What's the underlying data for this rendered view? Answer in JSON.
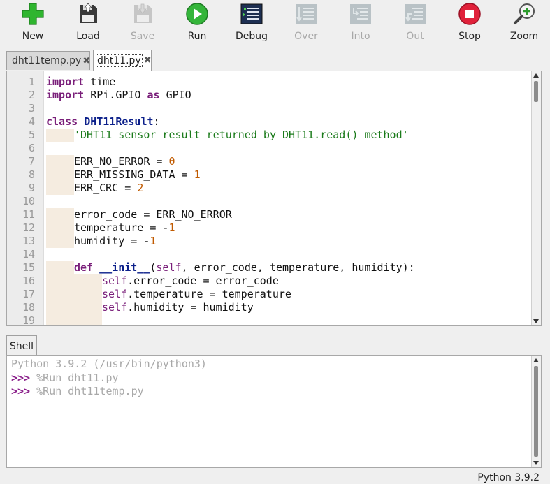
{
  "toolbar": {
    "items": [
      {
        "label": "New",
        "icon": "new-file-plus-icon",
        "enabled": true
      },
      {
        "label": "Load",
        "icon": "load-icon",
        "enabled": true
      },
      {
        "label": "Save",
        "icon": "save-icon",
        "enabled": false
      },
      {
        "label": "Run",
        "icon": "run-icon",
        "enabled": true
      },
      {
        "label": "Debug",
        "icon": "debug-icon",
        "enabled": true
      },
      {
        "label": "Over",
        "icon": "step-over-icon",
        "enabled": false
      },
      {
        "label": "Into",
        "icon": "step-into-icon",
        "enabled": false
      },
      {
        "label": "Out",
        "icon": "step-out-icon",
        "enabled": false
      },
      {
        "label": "Stop",
        "icon": "stop-icon",
        "enabled": true
      },
      {
        "label": "Zoom",
        "icon": "zoom-icon",
        "enabled": true
      }
    ]
  },
  "editor": {
    "tabs": [
      {
        "label": "dht11temp.py",
        "close": "✖",
        "active": false
      },
      {
        "label": "dht11.py",
        "close": "✖",
        "active": true
      }
    ],
    "line_numbers": [
      "1",
      "2",
      "3",
      "4",
      "5",
      "6",
      "7",
      "8",
      "9",
      "10",
      "11",
      "12",
      "13",
      "14",
      "15",
      "16",
      "17",
      "18",
      "19"
    ],
    "code": {
      "l1_kw": "import",
      "l1_rest": " time",
      "l2_kw": "import",
      "l2_mid": " RPi.GPIO ",
      "l2_as": "as",
      "l2_rest": " GPIO",
      "l4_kw": "class",
      "l4_name": "DHT11Result",
      "l4_colon": ":",
      "l5_str": "'DHT11 sensor result returned by DHT11.read() method'",
      "l7_a": "ERR_NO_ERROR = ",
      "l7_n": "0",
      "l8_a": "ERR_MISSING_DATA = ",
      "l8_n": "1",
      "l9_a": "ERR_CRC = ",
      "l9_n": "2",
      "l11_a": "error_code = ERR_NO_ERROR",
      "l12_a": "temperature = -",
      "l12_n": "1",
      "l13_a": "humidity = -",
      "l13_n": "1",
      "l15_kw": "def",
      "l15_name": "__init__",
      "l15_p": "(",
      "l15_self": "self",
      "l15_rest": ", error_code, temperature, humidity):",
      "l16_self": "self",
      "l16_rest": ".error_code = error_code",
      "l17_self": "self",
      "l17_rest": ".temperature = temperature",
      "l18_self": "self",
      "l18_rest": ".humidity = humidity"
    }
  },
  "shell": {
    "tab_label": "Shell",
    "version_line": "Python 3.9.2 (/usr/bin/python3)",
    "prompt": ">>>",
    "commands": [
      " %Run dht11.py",
      " %Run dht11temp.py"
    ]
  },
  "status": {
    "interpreter": "Python 3.9.2"
  },
  "colors": {
    "keyword": "#7a1f7a",
    "class_name": "#0b1f8a",
    "string": "#1a7a1a",
    "number": "#c05a00",
    "indent_guide": "#f5ece0"
  }
}
